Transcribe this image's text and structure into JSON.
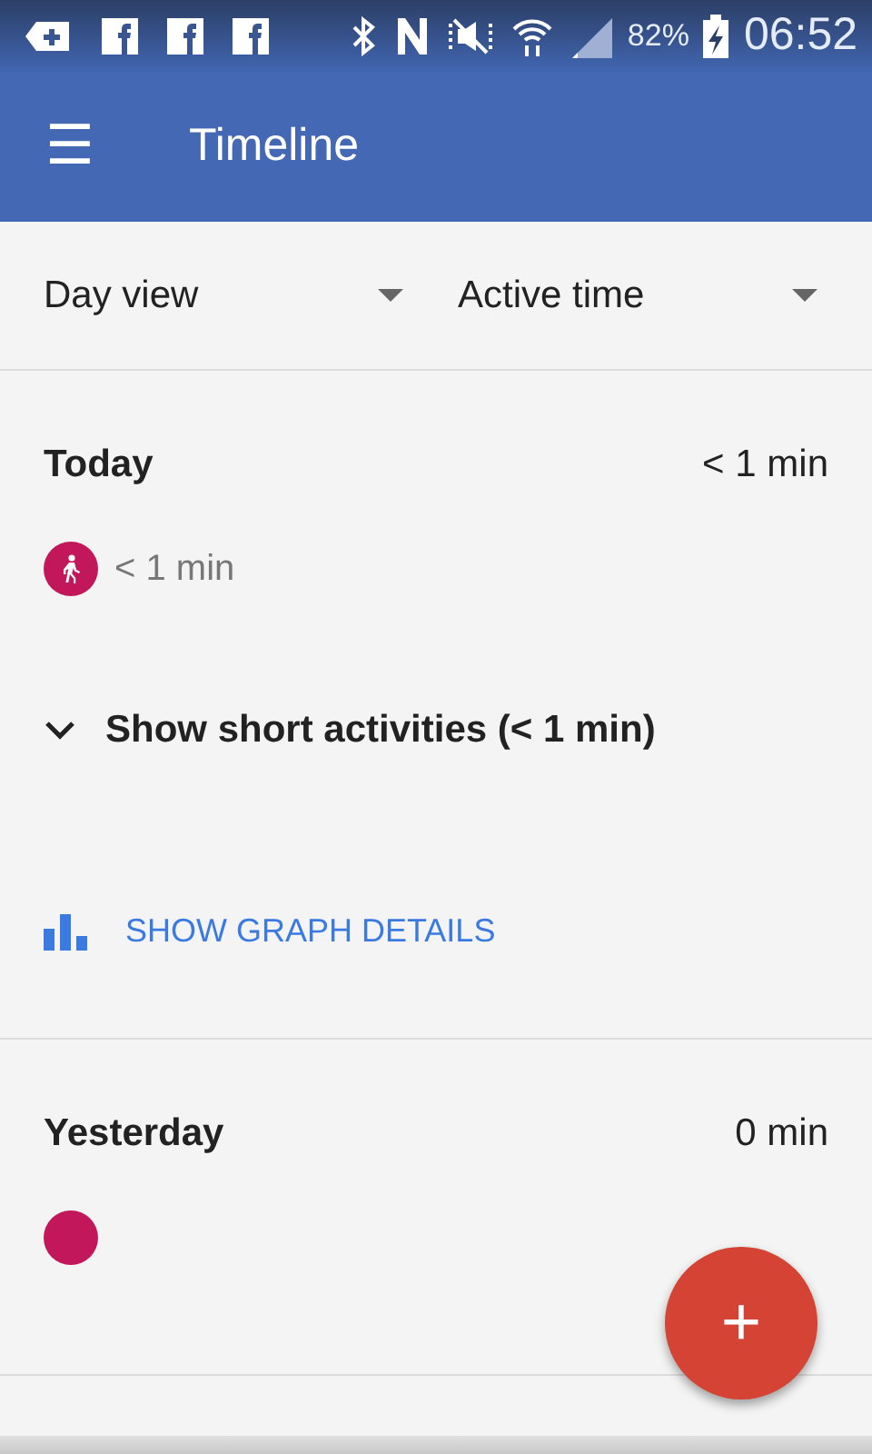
{
  "status_bar": {
    "battery": "82%",
    "time": "06:52"
  },
  "app_bar": {
    "menu_icon": "☰",
    "title": "Timeline"
  },
  "filters": [
    {
      "label": "Day view"
    },
    {
      "label": "Active time"
    }
  ],
  "days": [
    {
      "title": "Today",
      "total": "< 1 min",
      "activities": [
        {
          "kind": "walking",
          "color": "#c2185b",
          "duration": "< 1 min"
        }
      ],
      "short_toggle": {
        "label": "Show short activities (< 1 min)",
        "expanded": false
      },
      "graph_link": "SHOW GRAPH DETAILS"
    },
    {
      "title": "Yesterday",
      "total": "0 min",
      "activities": [
        {
          "kind": "empty",
          "color": "#c2185b"
        }
      ]
    }
  ],
  "fab": {
    "icon": "+"
  }
}
